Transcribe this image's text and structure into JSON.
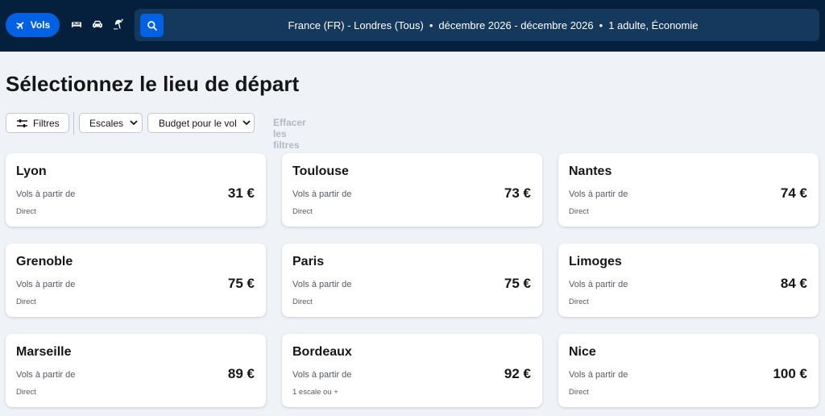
{
  "nav": {
    "active_tab_label": "Vols",
    "tabs": [
      {
        "name": "Vols",
        "icon": "airplane-icon"
      },
      {
        "name": "hotels",
        "icon": "bed-icon"
      },
      {
        "name": "car-hire",
        "icon": "car-icon"
      },
      {
        "name": "holidays",
        "icon": "beach-icon"
      }
    ]
  },
  "search": {
    "icon": "search-icon",
    "route": "France (FR) - Londres (Tous)",
    "dates": "décembre 2026 - décembre 2026",
    "travellers": "1 adulte, Économie",
    "separator": "•"
  },
  "page": {
    "title": "Sélectionnez le lieu de départ"
  },
  "filters": {
    "filters_label": "Filtres",
    "stops_label": "Escales",
    "budget_label": "Budget pour le vol",
    "clear_label": "Effacer les filtres"
  },
  "results": [
    {
      "city": "Lyon",
      "from_label": "Vols à partir de",
      "price": "31 €",
      "stops": "Direct"
    },
    {
      "city": "Toulouse",
      "from_label": "Vols à partir de",
      "price": "73 €",
      "stops": "Direct"
    },
    {
      "city": "Nantes",
      "from_label": "Vols à partir de",
      "price": "74 €",
      "stops": "Direct"
    },
    {
      "city": "Grenoble",
      "from_label": "Vols à partir de",
      "price": "75 €",
      "stops": "Direct"
    },
    {
      "city": "Paris",
      "from_label": "Vols à partir de",
      "price": "75 €",
      "stops": "Direct"
    },
    {
      "city": "Limoges",
      "from_label": "Vols à partir de",
      "price": "84 €",
      "stops": "Direct"
    },
    {
      "city": "Marseille",
      "from_label": "Vols à partir de",
      "price": "89 €",
      "stops": "Direct"
    },
    {
      "city": "Bordeaux",
      "from_label": "Vols à partir de",
      "price": "92 €",
      "stops": "1 escale ou +"
    },
    {
      "city": "Nice",
      "from_label": "Vols à partir de",
      "price": "100 €",
      "stops": "Direct"
    }
  ],
  "colors": {
    "header_bg": "#05203c",
    "search_bg": "#15385d",
    "accent": "#0062e3",
    "page_bg": "#eff3f8"
  }
}
